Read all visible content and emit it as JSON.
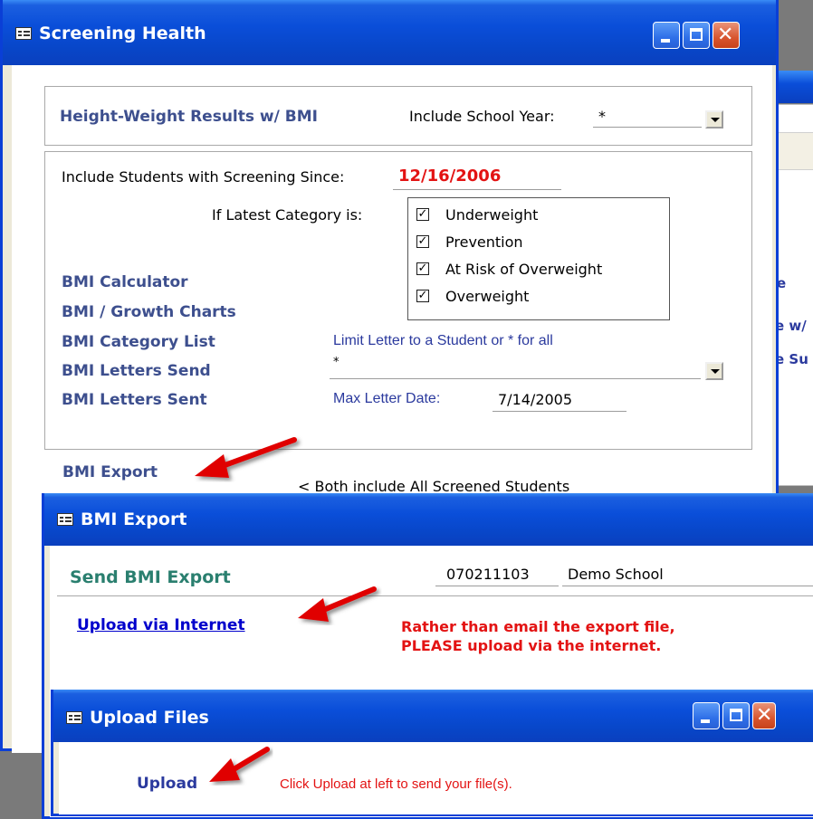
{
  "screening_window": {
    "title": "Screening Health",
    "report_label": "Height-Weight Results w/ BMI",
    "school_year_label": "Include School Year:",
    "school_year_value": "*",
    "since_label": "Include Students with Screening Since:",
    "since_value": "12/16/2006",
    "category_label": "If Latest Category is:",
    "categories": [
      {
        "label": "Underweight",
        "checked": true
      },
      {
        "label": "Prevention",
        "checked": true
      },
      {
        "label": "At Risk of Overweight",
        "checked": true
      },
      {
        "label": "Overweight",
        "checked": true
      }
    ],
    "links": [
      "BMI Calculator",
      "BMI / Growth Charts",
      "BMI Category List",
      "BMI Letters Send",
      "BMI Letters Sent"
    ],
    "limit_letter_label": "Limit Letter to a Student or * for all",
    "limit_letter_value": "*",
    "max_letter_label": "Max Letter Date:",
    "max_letter_value": "7/14/2005",
    "export_link": "BMI Export",
    "both_note": "< Both include All Screened Students"
  },
  "background_fragments": {
    "frag_e": "e",
    "frag_w": "e w/",
    "frag_su": "e Su"
  },
  "export_window": {
    "title": "BMI Export",
    "heading": "Send BMI Export",
    "school_code": "070211103",
    "school_name": "Demo School",
    "upload_link": "Upload via Internet",
    "message_line1": "Rather than email the export file,",
    "message_line2": "PLEASE  upload via the internet."
  },
  "upload_window": {
    "title": "Upload Files",
    "upload_link": "Upload",
    "hint": "Click Upload at left to send your file(s)."
  },
  "colors": {
    "xp_title_blue": "#0a4ed9",
    "label_blue": "#3d4f8e",
    "red_text": "#e31313",
    "link_blue": "#0000cc",
    "green_heading": "#2a7f6f"
  },
  "icons": [
    "form-icon",
    "minimize-icon",
    "maximize-icon",
    "close-icon",
    "red-arrow-icon",
    "dropdown-arrow-icon",
    "checkbox-checked-icon"
  ]
}
